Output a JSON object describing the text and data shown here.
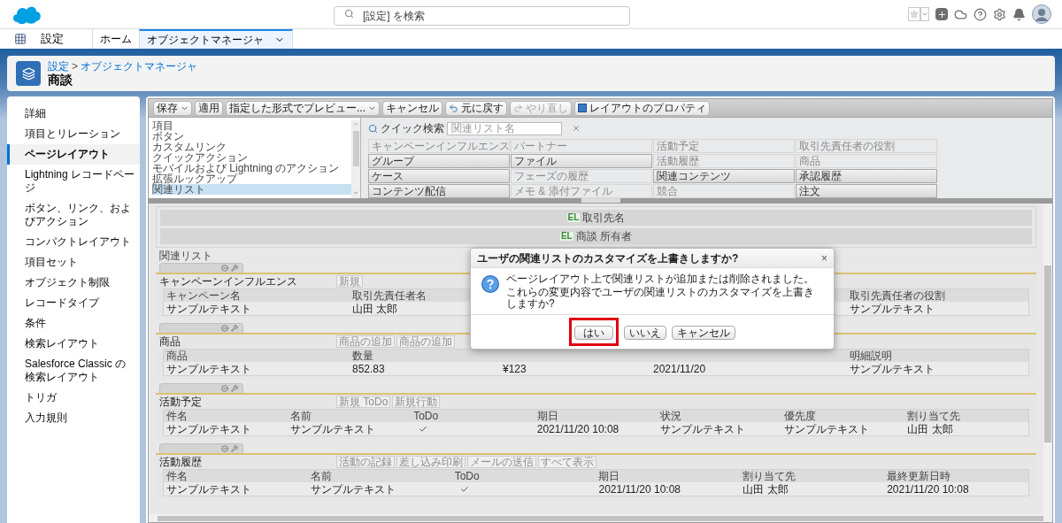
{
  "top_bar": {
    "search": {
      "placeholder": "[設定] を検索"
    }
  },
  "nav": {
    "app_name": "設定",
    "tabs": [
      {
        "label": "ホーム",
        "selected": false
      },
      {
        "label": "オブジェクトマネージャ",
        "selected": true
      }
    ]
  },
  "header": {
    "breadcrumb": [
      "設定",
      "オブジェクトマネージャ"
    ],
    "separator": ">",
    "title": "商談"
  },
  "sidebar": {
    "items": [
      {
        "label": "詳細",
        "selected": false
      },
      {
        "label": "項目とリレーション",
        "selected": false
      },
      {
        "label": "ページレイアウト",
        "selected": true
      },
      {
        "label": "Lightning レコードページ",
        "selected": false
      },
      {
        "label": "ボタン、リンク、およびアクション",
        "selected": false
      },
      {
        "label": "コンパクトレイアウト",
        "selected": false
      },
      {
        "label": "項目セット",
        "selected": false
      },
      {
        "label": "オブジェクト制限",
        "selected": false
      },
      {
        "label": "レコードタイプ",
        "selected": false
      },
      {
        "label": "条件",
        "selected": false
      },
      {
        "label": "検索レイアウト",
        "selected": false
      },
      {
        "label": "Salesforce Classic の検索レイアウト",
        "selected": false
      },
      {
        "label": "トリガ",
        "selected": false
      },
      {
        "label": "入力規則",
        "selected": false
      }
    ]
  },
  "toolbar": [
    {
      "label": "保存",
      "kind": "menu",
      "disabled": false
    },
    {
      "label": "適用",
      "kind": "plain",
      "disabled": false
    },
    {
      "label": "指定した形式でプレビュー...",
      "kind": "menu",
      "disabled": false
    },
    {
      "label": "キャンセル",
      "kind": "plain",
      "disabled": false
    },
    {
      "label": "元に戻す",
      "kind": "undo",
      "disabled": false
    },
    {
      "label": "やり直し",
      "kind": "redo",
      "disabled": true
    },
    {
      "label": "レイアウトのプロパティ",
      "kind": "properties",
      "disabled": false
    }
  ],
  "palette": {
    "categories": [
      {
        "label": "項目",
        "selected": false
      },
      {
        "label": "ボタン",
        "selected": false
      },
      {
        "label": "カスタムリンク",
        "selected": false
      },
      {
        "label": "クイックアクション",
        "selected": false
      },
      {
        "label": "モバイルおよび Lightning のアクション",
        "selected": false
      },
      {
        "label": "拡張ルックアップ",
        "selected": false
      },
      {
        "label": "関連リスト",
        "selected": true
      }
    ],
    "quick_search": {
      "label": "クイック検索",
      "placeholder": "関連リスト名"
    },
    "items": [
      {
        "label": "キャンペーンインフルエンス",
        "used": true
      },
      {
        "label": "パートナー",
        "used": true
      },
      {
        "label": "活動予定",
        "used": true
      },
      {
        "label": "取引先責任者の役割",
        "used": true
      },
      {
        "label": "グループ",
        "used": false
      },
      {
        "label": "ファイル",
        "used": false
      },
      {
        "label": "活動履歴",
        "used": true
      },
      {
        "label": "商品",
        "used": true
      },
      {
        "label": "ケース",
        "used": false
      },
      {
        "label": "フェーズの履歴",
        "used": true
      },
      {
        "label": "関連コンテンツ",
        "used": false
      },
      {
        "label": "承認履歴",
        "used": false
      },
      {
        "label": "コンテンツ配信",
        "used": false
      },
      {
        "label": "メモ & 添付ファイル",
        "used": true
      },
      {
        "label": "競合",
        "used": true
      },
      {
        "label": "注文",
        "used": false
      }
    ]
  },
  "layout": {
    "fields": [
      {
        "badge": "EL",
        "label": "取引先名"
      },
      {
        "badge": "EL",
        "label": "商談 所有者"
      }
    ],
    "related_lists_label": "関連リスト",
    "related_lists": [
      {
        "title": "キャンペーンインフルエンス",
        "buttons": [
          "新規"
        ],
        "columns": [
          {
            "header": "キャンペーン名",
            "value": "サンプルテキスト"
          },
          {
            "header": "取引先責任者名",
            "value": "山田 太郎"
          },
          {},
          {
            "header": "取引先責任者の役割",
            "value": "サンプルテキスト"
          }
        ]
      },
      {
        "title": "商品",
        "buttons": [
          "商品の追加",
          "商品の追加"
        ],
        "columns": [
          {
            "header": "商品",
            "value": "サンプルテキスト"
          },
          {
            "header": "数量",
            "value": "852.83"
          },
          {
            "value": "¥123"
          },
          {
            "value": "2021/11/20"
          },
          {
            "header": "明細説明",
            "value": "サンプルテキスト"
          }
        ]
      },
      {
        "title": "活動予定",
        "buttons": [
          "新規 ToDo",
          "新規行動"
        ],
        "columns": [
          {
            "header": "件名",
            "value": "サンプルテキスト"
          },
          {
            "header": "名前",
            "value": "サンプルテキスト"
          },
          {
            "header": "ToDo",
            "kind": "check",
            "checked": true
          },
          {
            "header": "期日",
            "value": "2021/11/20 10:08"
          },
          {
            "header": "状況",
            "value": "サンプルテキスト"
          },
          {
            "header": "優先度",
            "value": "サンプルテキスト"
          },
          {
            "header": "割り当て先",
            "value": "山田 太郎"
          }
        ]
      },
      {
        "title": "活動履歴",
        "buttons": [
          "活動の記録",
          "差し込み印刷",
          "メールの送信",
          "すべて表示"
        ],
        "columns": [
          {
            "header": "件名",
            "value": "サンプルテキスト"
          },
          {
            "header": "名前",
            "value": "サンプルテキスト"
          },
          {
            "header": "ToDo",
            "kind": "check",
            "checked": true
          },
          {
            "header": "期日",
            "value": "2021/11/20 10:08"
          },
          {
            "header": "割り当て先",
            "value": "山田 太郎"
          },
          {
            "header": "最終更新日時",
            "value": "2021/11/20 10:08"
          }
        ]
      }
    ]
  },
  "dialog": {
    "title": "ユーザの関連リストのカスタマイズを上書きしますか?",
    "close": "×",
    "messages": [
      "ページレイアウト上で関連リストが追加または削除されました。",
      "これらの変更内容でユーザの関連リストのカスタマイズを上書きしますか?"
    ],
    "buttons": [
      {
        "label": "はい",
        "highlighted": true
      },
      {
        "label": "いいえ",
        "highlighted": false
      },
      {
        "label": "キャンセル",
        "highlighted": false
      }
    ]
  }
}
